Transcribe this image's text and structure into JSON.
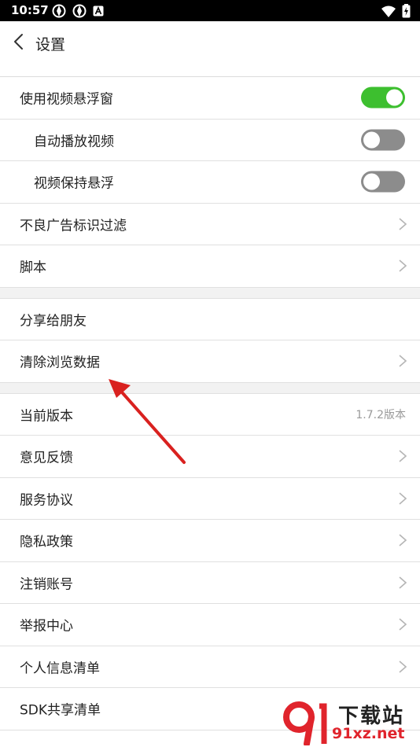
{
  "status_bar": {
    "time": "10:57",
    "icons_left": [
      "app-notification-icon",
      "app-notification-icon",
      "a-icon"
    ],
    "icons_right": [
      "wifi-icon",
      "battery-icon"
    ]
  },
  "header": {
    "title": "设置"
  },
  "colors": {
    "toggle_on": "#3dbf2f",
    "toggle_off": "#8c8c8c",
    "annotation_arrow": "#d9211f"
  },
  "settings": {
    "floating_video": {
      "label": "使用视频悬浮窗",
      "enabled": true
    },
    "autoplay_video": {
      "label": "自动播放视频",
      "enabled": false
    },
    "keep_floating": {
      "label": "视频保持悬浮",
      "enabled": false
    },
    "ad_filter": {
      "label": "不良广告标识过滤"
    },
    "script": {
      "label": "脚本"
    },
    "share": {
      "label": "分享给朋友"
    },
    "clear_data": {
      "label": "清除浏览数据"
    },
    "version": {
      "label": "当前版本",
      "value": "1.7.2版本"
    },
    "feedback": {
      "label": "意见反馈"
    },
    "service_agreement": {
      "label": "服务协议"
    },
    "privacy_policy": {
      "label": "隐私政策"
    },
    "cancel_account": {
      "label": "注销账号"
    },
    "report_center": {
      "label": "举报中心"
    },
    "personal_info_list": {
      "label": "个人信息清单"
    },
    "sdk_share_list": {
      "label": "SDK共享清单"
    }
  },
  "watermark": {
    "text": "下载站",
    "url": "91xz.net"
  }
}
